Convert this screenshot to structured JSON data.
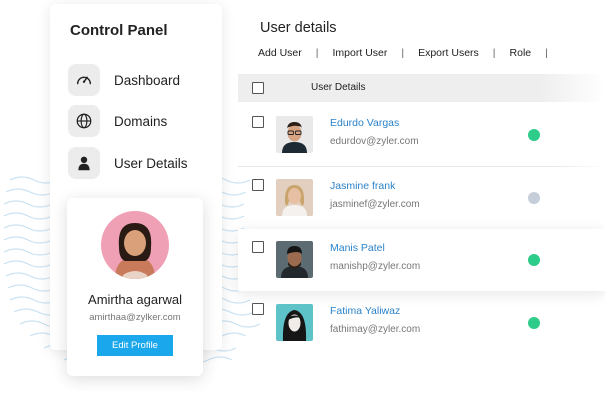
{
  "sidebar": {
    "title": "Control Panel",
    "items": [
      {
        "label": "Dashboard",
        "icon": "speedometer-icon"
      },
      {
        "label": "Domains",
        "icon": "globe-icon"
      },
      {
        "label": "User Details",
        "icon": "user-icon"
      }
    ]
  },
  "profile": {
    "name": "Amirtha agarwal",
    "email": "amirthaa@zylker.com",
    "edit_label": "Edit Profile",
    "avatar_bg": "#f0a0b4"
  },
  "main": {
    "title": "User details",
    "toolbar": [
      "Add User",
      "Import User",
      "Export Users",
      "Role"
    ],
    "table_header": "User Details"
  },
  "users": [
    {
      "name": "Edurdo Vargas",
      "email": "edurdov@zyler.com",
      "status_color": "#2ecc8a"
    },
    {
      "name": "Jasmine frank",
      "email": "jasminef@zyler.com",
      "status_color": "#c5ced8"
    },
    {
      "name": "Manis Patel",
      "email": "manishp@zyler.com",
      "status_color": "#2ecc8a"
    },
    {
      "name": "Fatima Yaliwaz",
      "email": "fathimay@zyler.com",
      "status_color": "#2ecc8a"
    }
  ],
  "colors": {
    "accent": "#1aa7ec",
    "link": "#2b82c9",
    "wave": "#c9e2f3"
  }
}
